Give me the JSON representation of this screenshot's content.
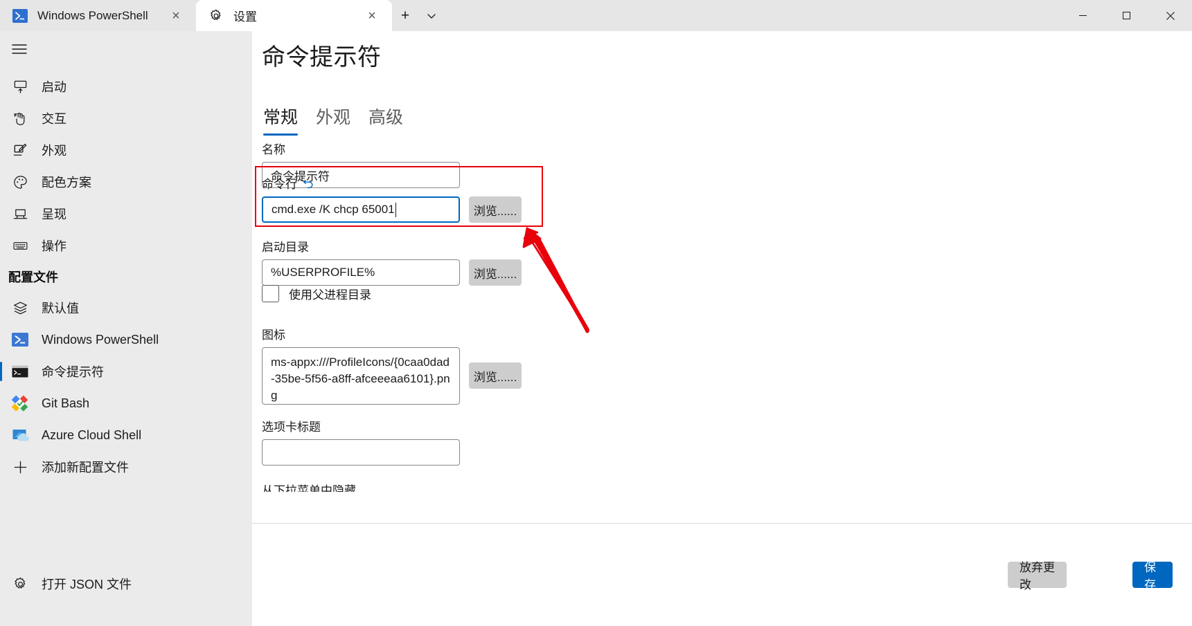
{
  "window": {
    "tabs": [
      {
        "icon": "powershell-icon",
        "title": "Windows PowerShell",
        "close": "×",
        "active": false
      },
      {
        "icon": "gear-icon",
        "title": "设置",
        "close": "×",
        "active": true
      }
    ],
    "new_tab_label": "+",
    "tab_menu_label": "⌵",
    "controls": {
      "minimize": "minimize-button",
      "maximize": "maximize-button",
      "close": "close-button"
    }
  },
  "sidebar": {
    "menu_button": "hamburger-menu",
    "items": [
      {
        "icon": "startup-icon",
        "label": "启动"
      },
      {
        "icon": "interaction-icon",
        "label": "交互"
      },
      {
        "icon": "appearance-icon",
        "label": "外观"
      },
      {
        "icon": "color-palette-icon",
        "label": "配色方案"
      },
      {
        "icon": "rendering-icon",
        "label": "呈现"
      },
      {
        "icon": "keyboard-icon",
        "label": "操作"
      }
    ],
    "profiles_header": "配置文件",
    "profiles": [
      {
        "icon": "layers-icon",
        "label": "默认值",
        "selected": false
      },
      {
        "icon": "powershell-icon",
        "label": "Windows PowerShell",
        "selected": false
      },
      {
        "icon": "cmd-icon",
        "label": "命令提示符",
        "selected": true
      },
      {
        "icon": "git-bash-icon",
        "label": "Git Bash",
        "selected": false
      },
      {
        "icon": "azure-cloud-shell-icon",
        "label": "Azure Cloud Shell",
        "selected": false
      },
      {
        "icon": "plus-icon",
        "label": "添加新配置文件",
        "selected": false
      }
    ],
    "open_json": {
      "icon": "gear-icon",
      "label": "打开 JSON 文件"
    }
  },
  "main": {
    "title": "命令提示符",
    "tabs": [
      {
        "label": "常规",
        "selected": true
      },
      {
        "label": "外观",
        "selected": false
      },
      {
        "label": "高级",
        "selected": false
      }
    ],
    "fields": {
      "name": {
        "label": "名称",
        "value": "命令提示符",
        "placeholder": ""
      },
      "commandline": {
        "label": "命令行",
        "reset_icon": "undo-arrow-icon",
        "value": "cmd.exe /K chcp 65001",
        "placeholder": "",
        "browse_label": "浏览......",
        "focused": true,
        "highlight_color": "#e8000b"
      },
      "startingdirectory": {
        "label": "启动目录",
        "value": "%USERPROFILE%",
        "placeholder": "",
        "browse_label": "浏览......"
      },
      "useparentdirectory": {
        "label": "使用父进程目录",
        "checked": false
      },
      "icon": {
        "label": "图标",
        "value": "ms-appx:///ProfileIcons/{0caa0dad-35be-5f56-a8ff-afceeeaa6101}.png",
        "placeholder": "",
        "browse_label": "浏览......"
      },
      "tabtitle": {
        "label": "选项卡标题",
        "value": "",
        "placeholder": ""
      },
      "hidefromdropdown": {
        "label": "从下拉菜单中隐藏"
      }
    },
    "footer": {
      "discard_label": "放弃更改",
      "save_label": "保存"
    },
    "annotation": {
      "arrow": "red-annotation-arrow",
      "color": "#e8000b"
    }
  },
  "colors": {
    "accent": "#0067c0",
    "sidebar_bg": "#ebebeb",
    "titlebar_bg": "#e6e6e6",
    "annotation_red": "#e8000b",
    "button_gray": "#cdcdcd"
  }
}
